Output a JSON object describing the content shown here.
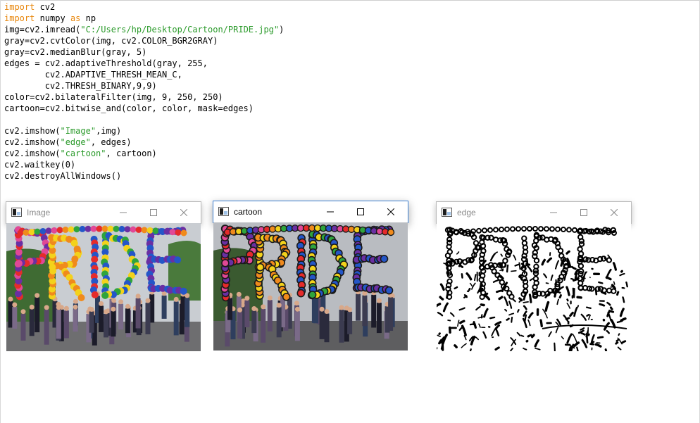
{
  "code": {
    "lines": [
      [
        {
          "t": "import",
          "c": "kw"
        },
        {
          "t": " cv2",
          "c": ""
        }
      ],
      [
        {
          "t": "import",
          "c": "kw"
        },
        {
          "t": " numpy ",
          "c": ""
        },
        {
          "t": "as",
          "c": "kw"
        },
        {
          "t": " np",
          "c": ""
        }
      ],
      [
        {
          "t": "img=cv2.imread(",
          "c": ""
        },
        {
          "t": "\"C:/Users/hp/Desktop/Cartoon/PRIDE.jpg\"",
          "c": "str"
        },
        {
          "t": ")",
          "c": ""
        }
      ],
      [
        {
          "t": "gray=cv2.cvtColor(img, cv2.COLOR_BGR2GRAY)",
          "c": ""
        }
      ],
      [
        {
          "t": "gray=cv2.medianBlur(gray, 5)",
          "c": ""
        }
      ],
      [
        {
          "t": "edges = cv2.adaptiveThreshold(gray, 255,",
          "c": ""
        }
      ],
      [
        {
          "t": "        cv2.ADAPTIVE_THRESH_MEAN_C,",
          "c": ""
        }
      ],
      [
        {
          "t": "        cv2.THRESH_BINARY,9,9)",
          "c": ""
        }
      ],
      [
        {
          "t": "color=cv2.bilateralFilter(img, 9, 250, 250)",
          "c": ""
        }
      ],
      [
        {
          "t": "cartoon=cv2.bitwise_and(color, color, mask=edges)",
          "c": ""
        }
      ],
      [],
      [
        {
          "t": "cv2.imshow(",
          "c": ""
        },
        {
          "t": "\"Image\"",
          "c": "str"
        },
        {
          "t": ",img)",
          "c": ""
        }
      ],
      [
        {
          "t": "cv2.imshow(",
          "c": ""
        },
        {
          "t": "\"edge\"",
          "c": "str"
        },
        {
          "t": ", edges)",
          "c": ""
        }
      ],
      [
        {
          "t": "cv2.imshow(",
          "c": ""
        },
        {
          "t": "\"cartoon\"",
          "c": "str"
        },
        {
          "t": ", cartoon)",
          "c": ""
        }
      ],
      [
        {
          "t": "cv2.waitkey(0)",
          "c": ""
        }
      ],
      [
        {
          "t": "cv2.destroyAllWindows()",
          "c": ""
        }
      ]
    ]
  },
  "windows": [
    {
      "id": "image",
      "title": "Image",
      "active": false,
      "picture": "pride-photo"
    },
    {
      "id": "cartoon",
      "title": "cartoon",
      "active": true,
      "picture": "pride-cartoon"
    },
    {
      "id": "edge",
      "title": "edge",
      "active": false,
      "picture": "pride-edges"
    }
  ],
  "colors": {
    "keyword": "#e8860c",
    "string": "#2a9a2a",
    "active_border": "#3c7fd1",
    "inactive_title": "#8a8a8a"
  },
  "icons": [
    "app-window-icon",
    "minimize-icon",
    "maximize-icon",
    "close-icon"
  ]
}
